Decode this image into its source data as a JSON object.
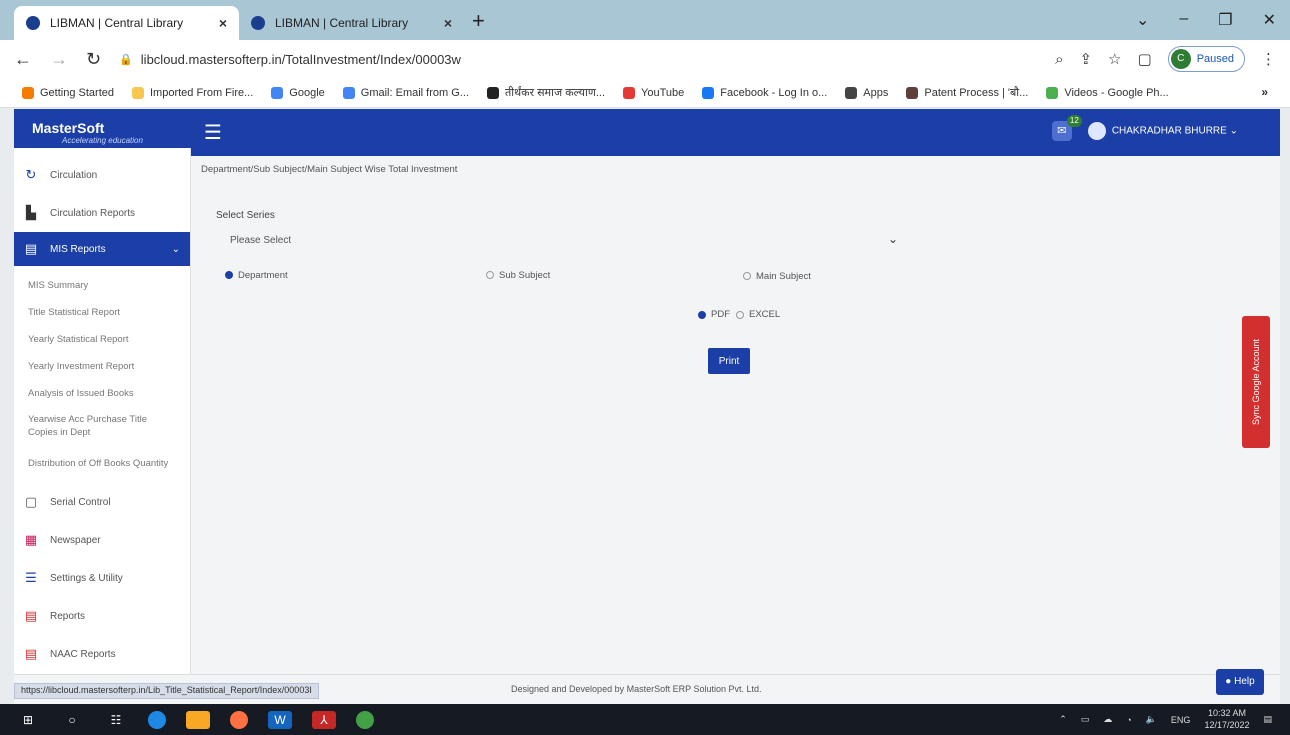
{
  "browser": {
    "tabs": [
      {
        "title": "LIBMAN | Central Library",
        "active": true
      },
      {
        "title": "LIBMAN | Central Library",
        "active": false
      }
    ],
    "url": "libcloud.mastersofterp.in/TotalInvestment/Index/00003w",
    "profile_status": "Paused",
    "profile_initial": "C",
    "bookmarks": [
      {
        "label": "Getting Started",
        "color": "#f57c00"
      },
      {
        "label": "Imported From Fire...",
        "color": "#f9c74f"
      },
      {
        "label": "Google",
        "color": "#4285f4"
      },
      {
        "label": "Gmail: Email from G...",
        "color": "#4285f4"
      },
      {
        "label": "तीर्थंकर समाज कल्याण...",
        "color": "#222222"
      },
      {
        "label": "YouTube",
        "color": "#e53935"
      },
      {
        "label": "Facebook - Log In o...",
        "color": "#1877f2"
      },
      {
        "label": "Apps",
        "color": "#444444"
      },
      {
        "label": "Patent Process | 'बौ...",
        "color": "#5d4037"
      },
      {
        "label": "Videos - Google Ph...",
        "color": "#4caf50"
      }
    ],
    "bookmarks_more": "»"
  },
  "app": {
    "logo_name": "MasterSoft",
    "logo_tagline": "Accelerating education",
    "notification_count": "12",
    "user_name": "CHAKRADHAR BHURRE"
  },
  "sidebar": {
    "items_top": [
      {
        "label": "Circulation",
        "icon": "refresh-icon"
      },
      {
        "label": "Circulation Reports",
        "icon": "chart-icon"
      }
    ],
    "active_label": "MIS Reports",
    "subitems": [
      "MIS Summary",
      "Title Statistical Report",
      "Yearly Statistical Report",
      "Yearly Investment Report",
      "Analysis of Issued Books",
      "Yearwise Acc Purchase Title Copies in Dept",
      "Distribution of Off Books Quantity"
    ],
    "items_bottom": [
      {
        "label": "Serial Control",
        "icon": "calendar-icon"
      },
      {
        "label": "Newspaper",
        "icon": "newspaper-icon"
      },
      {
        "label": "Settings & Utility",
        "icon": "settings-icon"
      },
      {
        "label": "Reports",
        "icon": "report-icon"
      },
      {
        "label": "NAAC Reports",
        "icon": "report-icon"
      }
    ]
  },
  "main": {
    "breadcrumb": "Department/Sub Subject/Main Subject Wise Total Investment",
    "series_label": "Select Series",
    "series_placeholder": "Please Select",
    "radios": [
      {
        "label": "Department",
        "checked": true
      },
      {
        "label": "Sub Subject",
        "checked": false
      },
      {
        "label": "Main Subject",
        "checked": false
      }
    ],
    "formats": [
      {
        "label": "PDF",
        "checked": true
      },
      {
        "label": "EXCEL",
        "checked": false
      }
    ],
    "print_label": "Print",
    "google_sync": "Sync Google Account"
  },
  "footer": {
    "text": "Designed and Developed by MasterSoft ERP Solution Pvt. Ltd.",
    "status_url": "https://libcloud.mastersofterp.in/Lib_Title_Statistical_Report/Index/00003I",
    "help_label": "Help"
  },
  "taskbar": {
    "lang": "ENG",
    "time": "10:32 AM",
    "date": "12/17/2022"
  }
}
